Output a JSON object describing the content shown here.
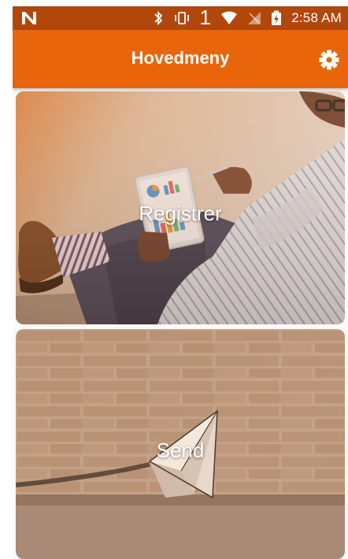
{
  "status_bar": {
    "time": "2:58 AM",
    "notification_badge": "1",
    "icons": [
      "n-logo-icon",
      "bluetooth-icon",
      "vibrate-icon",
      "wifi-icon",
      "no-signal-icon",
      "battery-charging-icon"
    ]
  },
  "app_bar": {
    "title": "Hovedmeny",
    "settings_icon": "gear-icon",
    "background_color": "#e8650c"
  },
  "menu": {
    "items": [
      {
        "label": "Registrer",
        "image": "person-holding-tablet-photo"
      },
      {
        "label": "Send",
        "image": "paper-plane-brick-wall-photo"
      }
    ]
  },
  "colors": {
    "status_bar": "#b2470b",
    "accent": "#e8650c",
    "label_text": "#ffffff"
  }
}
